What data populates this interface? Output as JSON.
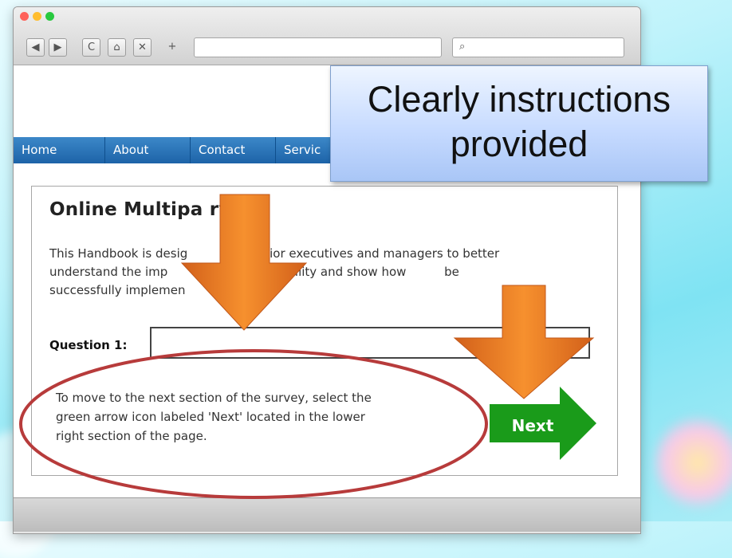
{
  "browser": {
    "back_glyph": "◀",
    "forward_glyph": "▶",
    "reload_glyph": "C",
    "home_glyph": "⌂",
    "close_glyph": "✕",
    "new_tab_glyph": "+",
    "search_glyph": "⌕"
  },
  "nav": {
    "items": [
      "Home",
      "About",
      "Contact",
      "Servic"
    ]
  },
  "survey": {
    "title": "Online Multipa    rvey",
    "intro_line1": "This Handbook is desig                senior executives and managers to better",
    "intro_line2": "understand the imp                    accessibility and show how          be",
    "intro_line3": "successfully implemen",
    "question_label": "Question 1:",
    "instruction_line1": "To move to the next section of the survey, select the",
    "instruction_line2": "green arrow icon labeled 'Next' located in the lower",
    "instruction_line3": "right section of the page.",
    "next_label": "Next"
  },
  "callout": {
    "line1": "Clearly instructions",
    "line2": "provided"
  },
  "colors": {
    "nav_blue": "#1d63a8",
    "next_green": "#1a9b1a",
    "arrow_orange": "#f07a1e",
    "ellipse_red": "#b73b3b"
  },
  "icons": {
    "back": "back-arrow-icon",
    "forward": "forward-arrow-icon",
    "reload": "reload-icon",
    "home": "home-icon",
    "close": "close-icon",
    "search": "search-icon"
  }
}
